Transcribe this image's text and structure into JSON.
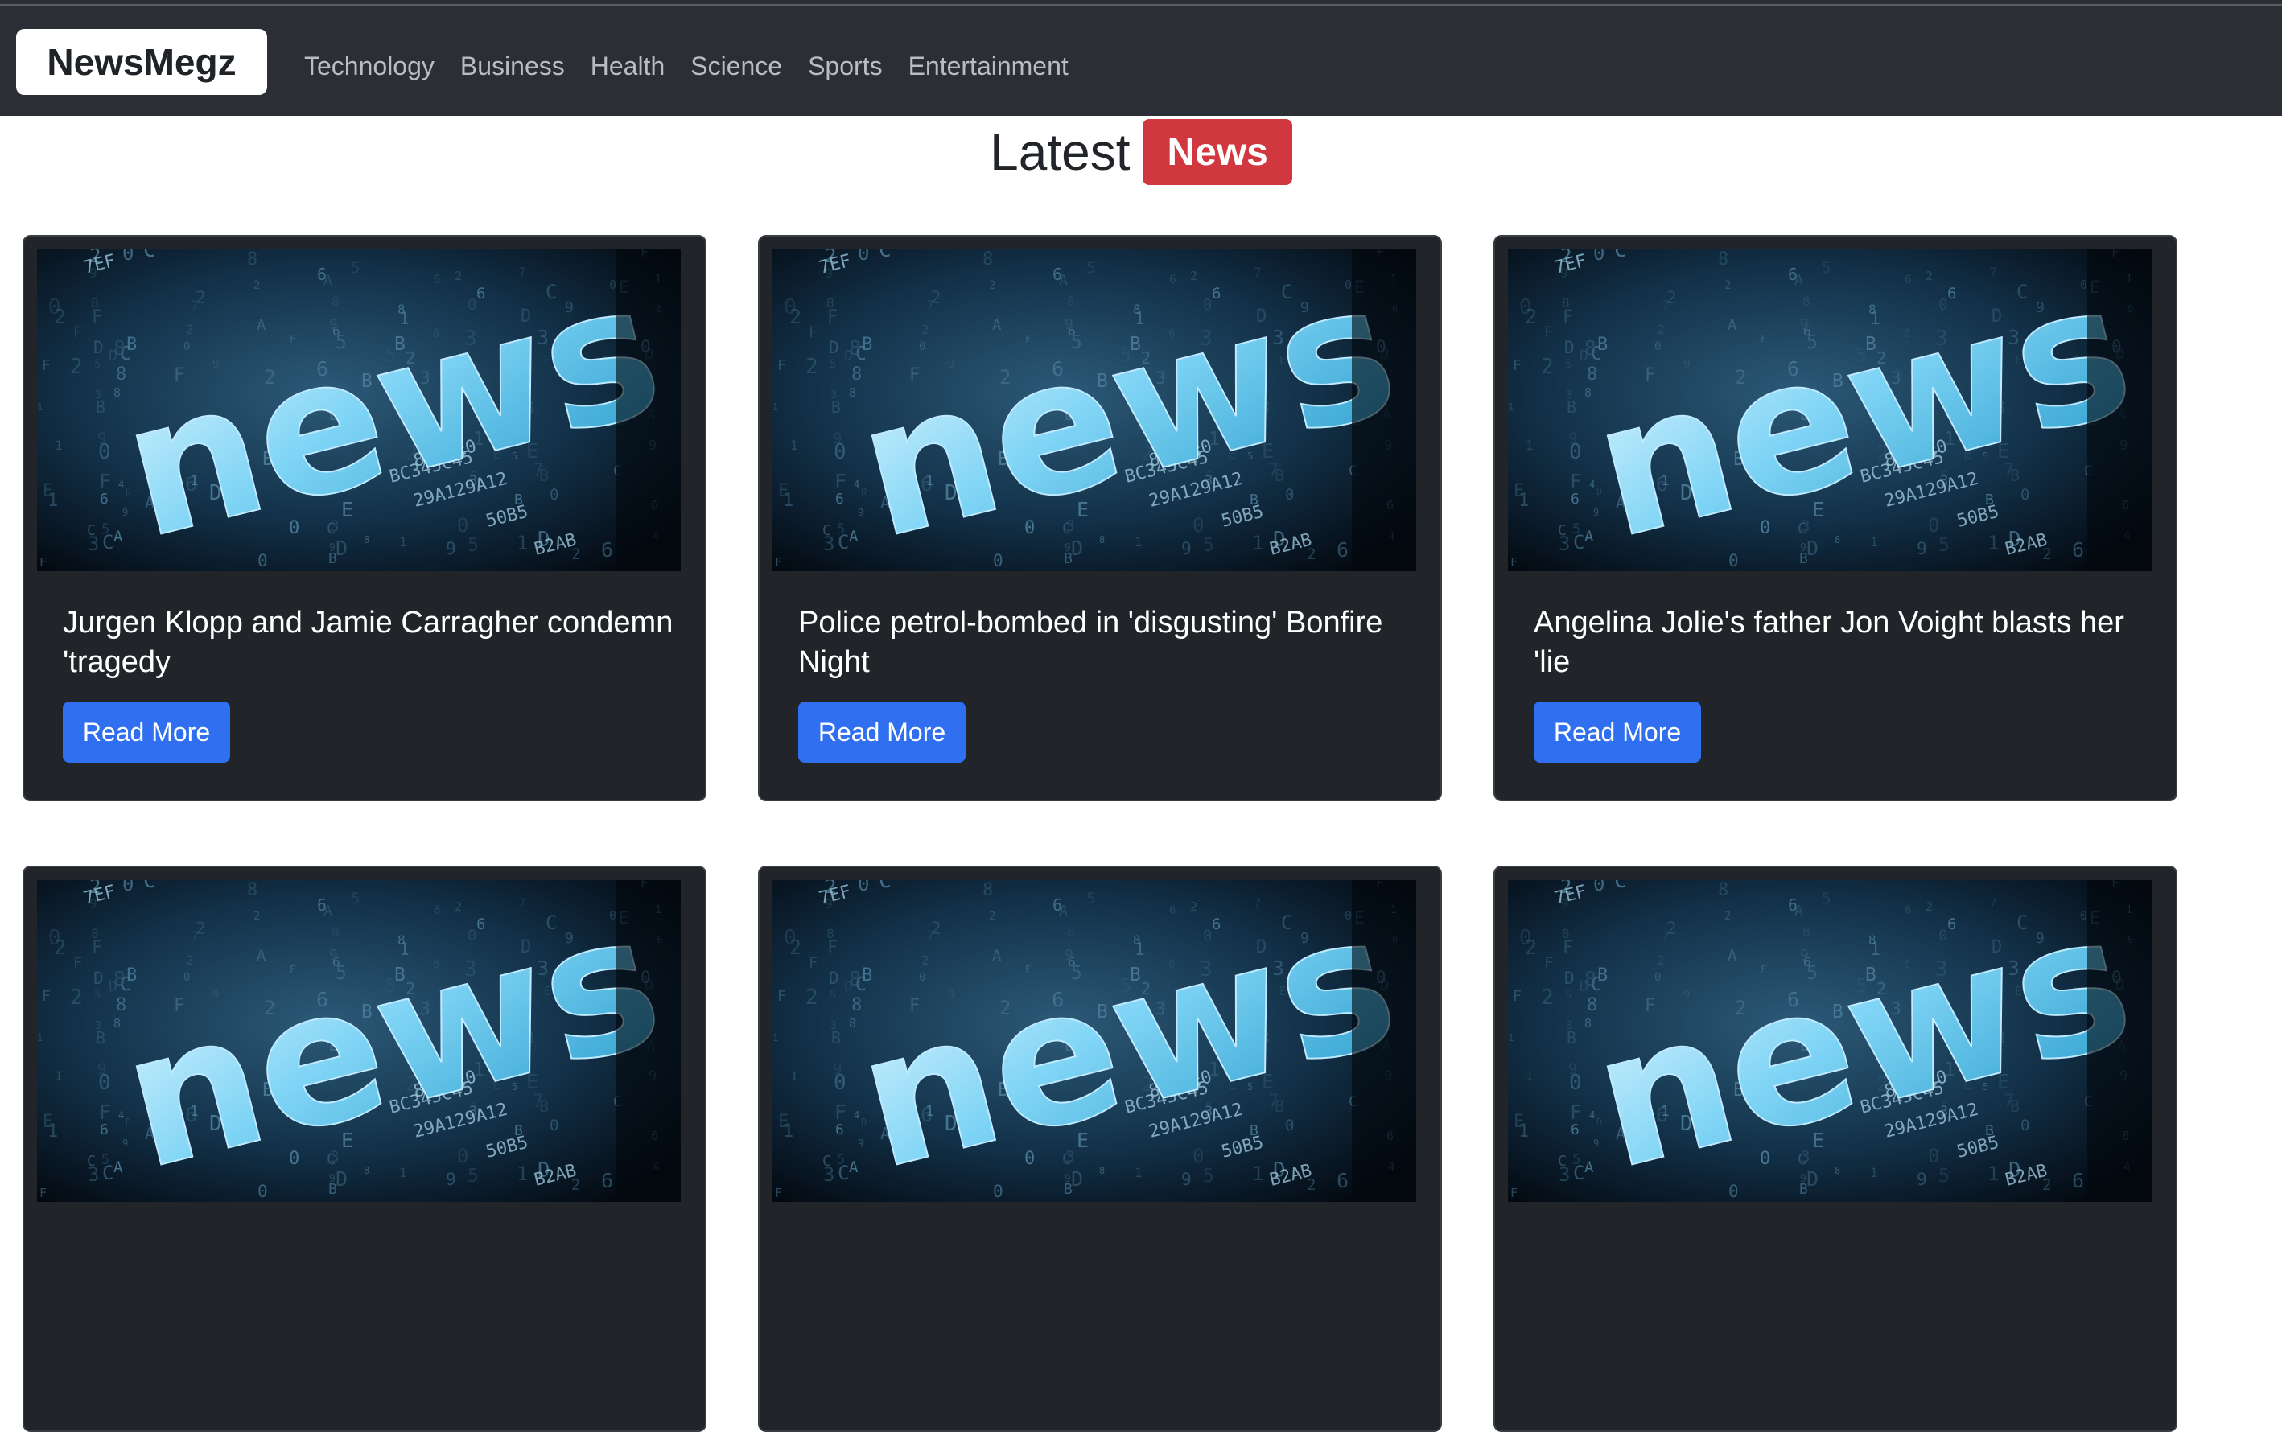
{
  "navbar": {
    "brand": "NewsMegz",
    "links": [
      "Technology",
      "Business",
      "Health",
      "Science",
      "Sports",
      "Entertainment"
    ]
  },
  "heading": {
    "text": "Latest",
    "badge": "News"
  },
  "cards": [
    {
      "title": "Jurgen Klopp and Jamie Carragher condemn 'tragedy",
      "button": "Read More",
      "image_word": "news",
      "image_codes": [
        "7EF",
        "BC345C45",
        "29A129A12",
        "50B5",
        "B2AB",
        "8B67E0"
      ]
    },
    {
      "title": "Police petrol-bombed in 'disgusting' Bonfire Night",
      "button": "Read More",
      "image_word": "news",
      "image_codes": [
        "7EF",
        "BC345C45",
        "29A129A12",
        "50B5",
        "B2AB",
        "8B67E0"
      ]
    },
    {
      "title": "Angelina Jolie's father Jon Voight blasts her 'lie",
      "button": "Read More",
      "image_word": "news",
      "image_codes": [
        "7EF",
        "BC345C45",
        "29A129A12",
        "50B5",
        "B2AB",
        "8B67E0"
      ]
    },
    {
      "title": "",
      "button": "",
      "image_word": "news",
      "image_codes": [
        "7EF",
        "BC345C45",
        "29A129A12",
        "50B5",
        "B2AB",
        "8B67E0"
      ]
    },
    {
      "title": "",
      "button": "",
      "image_word": "news",
      "image_codes": [
        "7EF",
        "BC345C45",
        "29A129A12",
        "50B5",
        "B2AB",
        "8B67E0"
      ]
    },
    {
      "title": "",
      "button": "",
      "image_word": "news",
      "image_codes": [
        "7EF",
        "BC345C45",
        "29A129A12",
        "50B5",
        "B2AB",
        "8B67E0"
      ]
    }
  ],
  "colors": {
    "navbar_bg": "#2b2f35",
    "card_bg": "#212429",
    "badge_red": "#d1373f",
    "button_blue": "#2f6ff0"
  }
}
